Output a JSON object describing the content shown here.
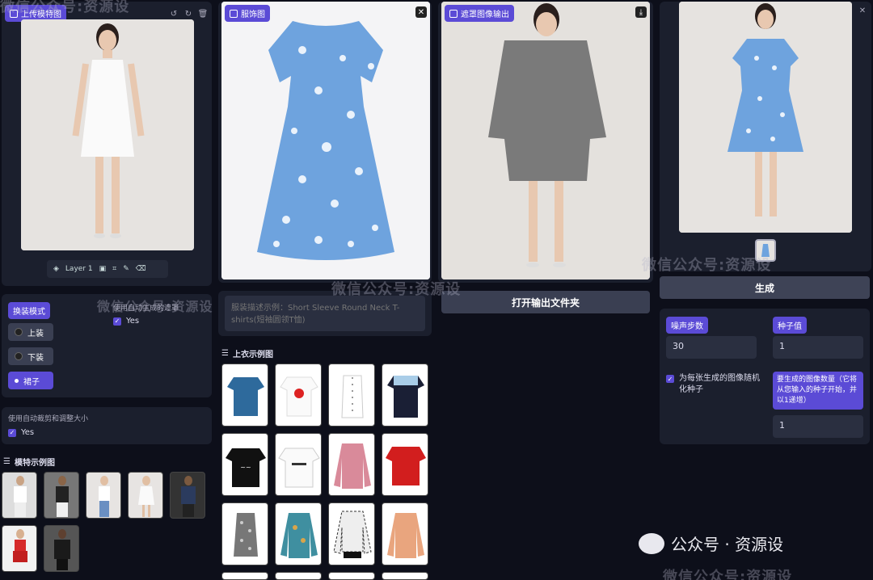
{
  "model_panel": {
    "tag": "上传模特图",
    "layer_label": "Layer 1"
  },
  "garment_panel": {
    "tag": "服饰图"
  },
  "mask_panel": {
    "tag": "遮罩图像输出",
    "open_folder_button": "打开输出文件夹"
  },
  "result_panel": {
    "generate_button": "生成"
  },
  "mode": {
    "label": "换装模式",
    "options": [
      "上装",
      "下装",
      "裙子"
    ],
    "selected": "裙子"
  },
  "auto_gen_mask": {
    "label": "使用自动生成的遮罩",
    "value": "Yes"
  },
  "auto_crop": {
    "label": "使用自动裁剪和调整大小",
    "value": "Yes"
  },
  "garment_desc": {
    "placeholder": "服装描述示例：Short Sleeve Round Neck T-shirts(短袖圆领T恤)"
  },
  "top_examples_title": "上衣示例图",
  "model_examples_title": "模特示例图",
  "params": {
    "steps_label": "噪声步数",
    "steps_value": "30",
    "seed_label": "种子值",
    "seed_value": "1",
    "randomize_label": "为每张生成的图像随机化种子",
    "num_images_label": "要生成的图像数量（它将从您输入的种子开始，并以1递增）",
    "num_images_value": "1"
  },
  "watermarks": {
    "top": "微信公众号:资源设",
    "mid": "微信公众号:资源设",
    "right": "微信公众号:资源设",
    "bottom": "微信公众号:资源设",
    "footer": "公众号 · 资源设"
  },
  "colors": {
    "accent": "#5b4bd6",
    "panel": "#1b1f2d",
    "background": "#0d0f1a"
  }
}
